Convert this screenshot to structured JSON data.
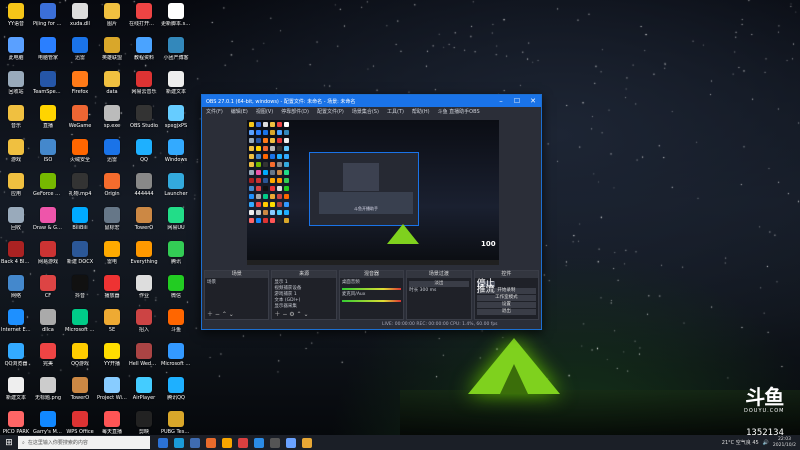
{
  "desktop_icons": [
    {
      "label": "YY语音",
      "color": "#f5c518"
    },
    {
      "label": "Piling for the Finish Mo",
      "color": "#3b6fd8"
    },
    {
      "label": "xuda.dll",
      "color": "#ddd"
    },
    {
      "label": "图片",
      "color": "#f0c040"
    },
    {
      "label": "在线打开方便转换器",
      "color": "#e44"
    },
    {
      "label": "更新脚本.skin",
      "color": "#fff"
    },
    {
      "label": "此电脑",
      "color": "#5aa0ff"
    },
    {
      "label": "电脑管家",
      "color": "#2a7fff"
    },
    {
      "label": "迅雷",
      "color": "#1a73e8"
    },
    {
      "label": "英雄联盟",
      "color": "#d9a72a"
    },
    {
      "label": "教程资料",
      "color": "#4aa3ff"
    },
    {
      "label": "小团产博客",
      "color": "#38b"
    },
    {
      "label": "回收站",
      "color": "#9ab"
    },
    {
      "label": "TeamSpeak 3",
      "color": "#2556a8"
    },
    {
      "label": "Firefox",
      "color": "#ff7a18"
    },
    {
      "label": "data",
      "color": "#f0c040"
    },
    {
      "label": "网易云音乐",
      "color": "#d33"
    },
    {
      "label": "新建文本",
      "color": "#eee"
    },
    {
      "label": "音乐",
      "color": "#f0c040"
    },
    {
      "label": "直播",
      "color": "#ffd400"
    },
    {
      "label": "WeGame",
      "color": "#e63"
    },
    {
      "label": "sp.exe",
      "color": "#bbb"
    },
    {
      "label": "OBS Studio",
      "color": "#333"
    },
    {
      "label": "spxgjxPS",
      "color": "#6cf"
    },
    {
      "label": "游戏",
      "color": "#f0c040"
    },
    {
      "label": "ISO",
      "color": "#48c"
    },
    {
      "label": "火绒安全",
      "color": "#f60"
    },
    {
      "label": "迅雷",
      "color": "#1a73e8"
    },
    {
      "label": "QQ",
      "color": "#1eb0ff"
    },
    {
      "label": "Windows",
      "color": "#3af"
    },
    {
      "label": "应用",
      "color": "#f0c040"
    },
    {
      "label": "GeForce Experience",
      "color": "#76b900"
    },
    {
      "label": "礼物.mp4",
      "color": "#333"
    },
    {
      "label": "Origin",
      "color": "#f56c2d"
    },
    {
      "label": "444444",
      "color": "#888"
    },
    {
      "label": "Launcher",
      "color": "#3ad"
    },
    {
      "label": "回收",
      "color": "#9ab"
    },
    {
      "label": "Draw & Guess",
      "color": "#e5a"
    },
    {
      "label": "BiliBili",
      "color": "#0af"
    },
    {
      "label": "鼠标宏",
      "color": "#678"
    },
    {
      "label": "TowerO",
      "color": "#c84"
    },
    {
      "label": "网易UU",
      "color": "#2d8"
    },
    {
      "label": "Back 4 Blood Beta",
      "color": "#a22"
    },
    {
      "label": "网易游戏",
      "color": "#c33"
    },
    {
      "label": "新建 DOCX",
      "color": "#2b5797"
    },
    {
      "label": "雷电",
      "color": "#fa0"
    },
    {
      "label": "Everything",
      "color": "#f90"
    },
    {
      "label": "腾讯",
      "color": "#3c5"
    },
    {
      "label": "网络",
      "color": "#48c"
    },
    {
      "label": "CF",
      "color": "#d44"
    },
    {
      "label": "抖音",
      "color": "#111"
    },
    {
      "label": "播放器",
      "color": "#e33"
    },
    {
      "label": "作业",
      "color": "#ddd"
    },
    {
      "label": "微信",
      "color": "#2c2"
    },
    {
      "label": "Internet Explorer",
      "color": "#1e90ff"
    },
    {
      "label": "dllca",
      "color": "#aaa"
    },
    {
      "label": "Microsoft Edge",
      "color": "#0c8"
    },
    {
      "label": "5E",
      "color": "#ea3"
    },
    {
      "label": "招入",
      "color": "#c44"
    },
    {
      "label": "斗鱼",
      "color": "#f60"
    },
    {
      "label": "QQ浏览器",
      "color": "#3af"
    },
    {
      "label": "完美",
      "color": "#e44"
    },
    {
      "label": "QQ游戏",
      "color": "#fc0"
    },
    {
      "label": "YY开播",
      "color": "#fd0"
    },
    {
      "label": "Hell Wedding",
      "color": "#a44"
    },
    {
      "label": "Microsoft Store",
      "color": "#39f"
    },
    {
      "label": "新建文本",
      "color": "#eee"
    },
    {
      "label": "无标题.png",
      "color": "#ccc"
    },
    {
      "label": "TowerO",
      "color": "#c84"
    },
    {
      "label": "Project Winter",
      "color": "#8cf"
    },
    {
      "label": "AirPlayer",
      "color": "#4cf"
    },
    {
      "label": "腾讯QQ",
      "color": "#1eb0ff"
    },
    {
      "label": "PICO PARK",
      "color": "#f66"
    },
    {
      "label": "Garry's Mod",
      "color": "#18f"
    },
    {
      "label": "WPS Office",
      "color": "#d33"
    },
    {
      "label": "每天直播",
      "color": "#f55"
    },
    {
      "label": "剪映",
      "color": "#222"
    },
    {
      "label": "PUBG Test Server",
      "color": "#d9a72a"
    }
  ],
  "obs": {
    "title": "OBS 27.0.1 (64-bit, windows) - 配置文件: 未命名 - 场景: 未命名",
    "menu": [
      "文件(F)",
      "编辑(E)",
      "视图(V)",
      "停靠部件(D)",
      "配置文件(P)",
      "场景集合(S)",
      "工具(T)",
      "帮助(H)",
      "斗鱼 直播助手OBS"
    ],
    "preview_dialog": "斗鱼开播助手",
    "preview_logo": "100",
    "docks": {
      "scenes": {
        "header": "场景",
        "items": [
          "场景"
        ]
      },
      "sources": {
        "header": "来源",
        "items": [
          "显示 1",
          "视频捕获设备",
          "游戏捕获 1",
          "文本 (GDI+)",
          "显示器采集"
        ]
      },
      "mixer": {
        "header": "混音器",
        "items": [
          "桌面音频",
          "麦克风/Aux"
        ]
      },
      "transitions": {
        "header": "场景过渡",
        "mode": "淡出",
        "duration_label": "时长",
        "duration": "300 ms"
      },
      "controls": {
        "header": "控件",
        "buttons": [
          "停止推流",
          "开始录制",
          "工作室模式",
          "设置",
          "退出"
        ]
      }
    },
    "statusbar": "LIVE: 00:00:00   REC: 00:00:00   CPU: 1.4%, 60.00 fps"
  },
  "taskbar": {
    "search_placeholder": "在这里输入你要搜索的内容",
    "apps": [
      "#2b72d6",
      "#1b9bd8",
      "#3f6cb1",
      "#e86b2c",
      "#f7a600",
      "#da4040",
      "#2b8ce6",
      "#555",
      "#6aa2ff",
      "#e7a735"
    ],
    "weather": "21°C 空气良 45",
    "time": "22:03",
    "date": "2021/10/2"
  },
  "watermark": {
    "logo": "斗鱼",
    "site": "DOUYU.COM",
    "room": "1352134"
  }
}
